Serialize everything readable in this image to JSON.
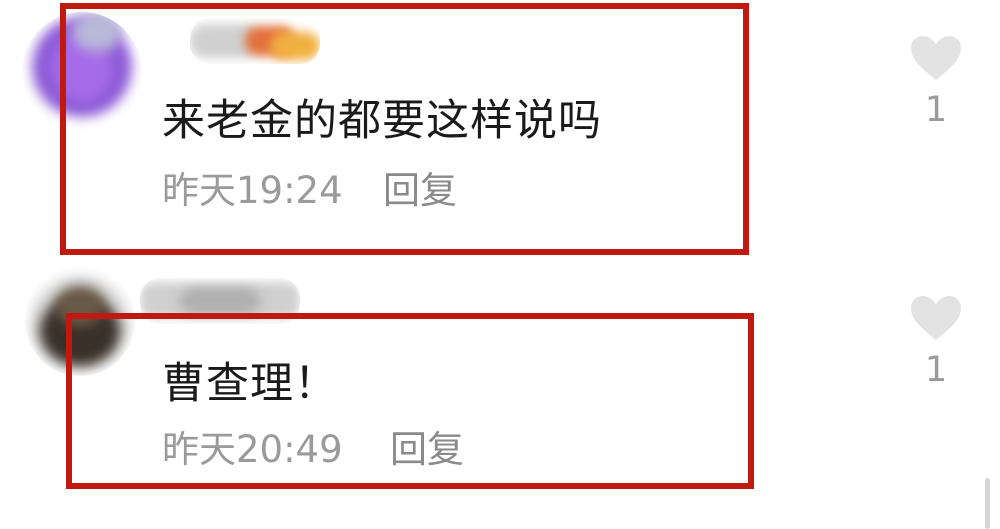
{
  "comments": [
    {
      "text": "来老金的都要这样说吗",
      "time": "昨天19:24",
      "reply_label": "回复",
      "likes": "1",
      "avatar_color": "#7a3fd0"
    },
    {
      "text": "曹查理！",
      "time": "昨天20:49",
      "reply_label": "回复",
      "likes": "1",
      "avatar_color": "#3a3028"
    }
  ],
  "colors": {
    "highlight_box": "#c01a10",
    "heart": "#e3e3e3",
    "secondary_text": "#9a9a9a"
  },
  "icons": {
    "like": "heart-icon"
  }
}
